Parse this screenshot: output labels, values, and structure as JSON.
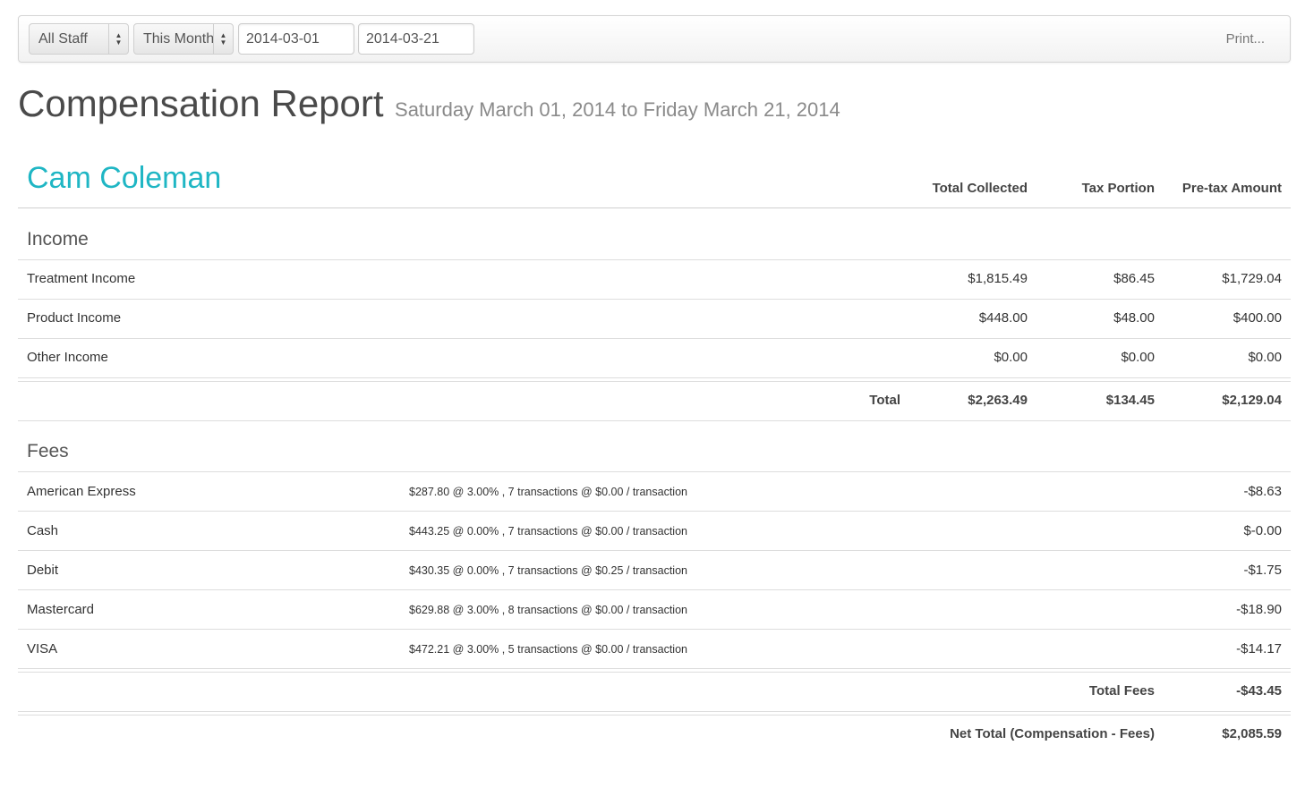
{
  "toolbar": {
    "staff_select": "All Staff",
    "period_select": "This Month",
    "start_date": "2014-03-01",
    "end_date": "2014-03-21",
    "print_label": "Print..."
  },
  "header": {
    "title": "Compensation Report",
    "subtitle": "Saturday March 01, 2014 to Friday March 21, 2014"
  },
  "report": {
    "staff_name": "Cam Coleman",
    "columns": [
      "Total Collected",
      "Tax Portion",
      "Pre-tax Amount"
    ],
    "income": {
      "title": "Income",
      "rows": [
        {
          "label": "Treatment Income",
          "collected": "$1,815.49",
          "tax": "$86.45",
          "pretax": "$1,729.04"
        },
        {
          "label": "Product Income",
          "collected": "$448.00",
          "tax": "$48.00",
          "pretax": "$400.00"
        },
        {
          "label": "Other Income",
          "collected": "$0.00",
          "tax": "$0.00",
          "pretax": "$0.00"
        }
      ],
      "total_label": "Total",
      "total_collected": "$2,263.49",
      "total_tax": "$134.45",
      "total_pretax": "$2,129.04"
    },
    "fees": {
      "title": "Fees",
      "rows": [
        {
          "label": "American Express",
          "detail": "$287.80 @ 3.00% , 7 transactions @ $0.00 / transaction",
          "amount": "-$8.63"
        },
        {
          "label": "Cash",
          "detail": "$443.25 @ 0.00% , 7 transactions @ $0.00 / transaction",
          "amount": "$-0.00"
        },
        {
          "label": "Debit",
          "detail": "$430.35 @ 0.00% , 7 transactions @ $0.25 / transaction",
          "amount": "-$1.75"
        },
        {
          "label": "Mastercard",
          "detail": "$629.88 @ 3.00% , 8 transactions @ $0.00 / transaction",
          "amount": "-$18.90"
        },
        {
          "label": "VISA",
          "detail": "$472.21 @ 3.00% , 5 transactions @ $0.00 / transaction",
          "amount": "-$14.17"
        }
      ],
      "total_label": "Total Fees",
      "total_amount": "-$43.45"
    },
    "net_label": "Net Total (Compensation - Fees)",
    "net_amount": "$2,085.59"
  }
}
